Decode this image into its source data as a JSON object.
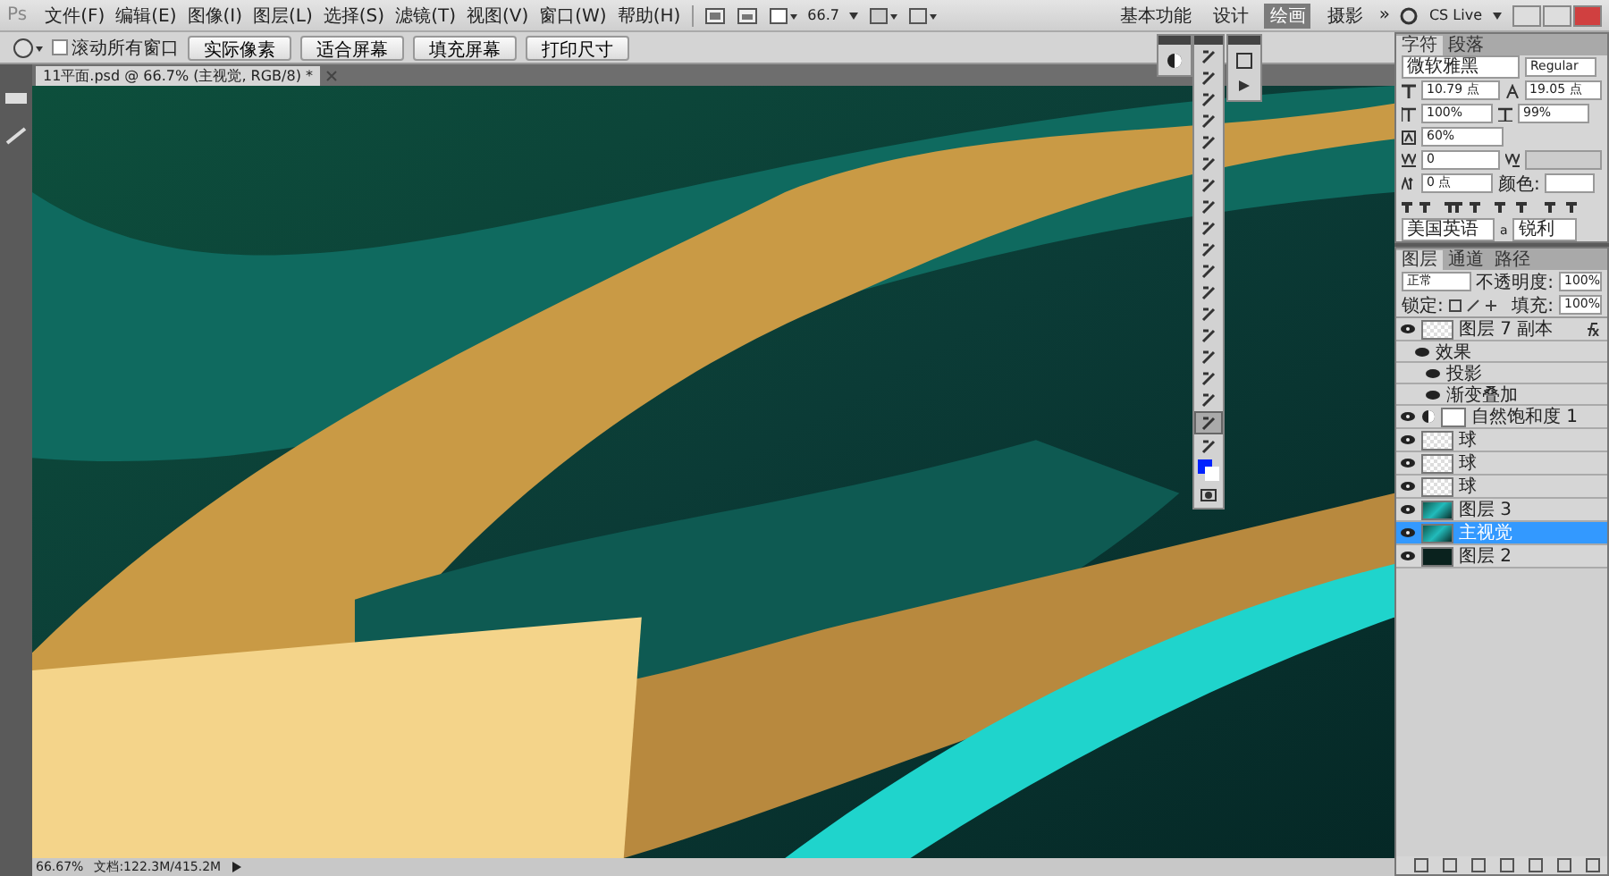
{
  "menu": {
    "logo": "Ps",
    "items": [
      "文件(F)",
      "编辑(E)",
      "图像(I)",
      "图层(L)",
      "选择(S)",
      "滤镜(T)",
      "视图(V)",
      "窗口(W)",
      "帮助(H)"
    ],
    "zoom": "66.7",
    "workspaces": [
      {
        "label": "基本功能",
        "selected": false
      },
      {
        "label": "设计",
        "selected": false
      },
      {
        "label": "绘画",
        "selected": true
      },
      {
        "label": "摄影",
        "selected": false
      }
    ],
    "more": "»",
    "cs_live": "CS Live"
  },
  "options": {
    "scroll_all": {
      "label": "滚动所有窗口",
      "checked": false
    },
    "buttons": [
      "实际像素",
      "适合屏幕",
      "填充屏幕",
      "打印尺寸"
    ]
  },
  "document": {
    "tab": "11平面.psd @ 66.7% (主视觉, RGB/8) *"
  },
  "tools": [
    {
      "selected": false
    },
    {
      "selected": false
    },
    {
      "selected": false
    },
    {
      "selected": false
    },
    {
      "selected": false
    },
    {
      "selected": false
    },
    {
      "selected": false
    },
    {
      "selected": false
    },
    {
      "selected": false
    },
    {
      "selected": false
    },
    {
      "selected": false
    },
    {
      "selected": false
    },
    {
      "selected": false
    },
    {
      "selected": false
    },
    {
      "selected": false
    },
    {
      "selected": false
    },
    {
      "selected": false
    },
    {
      "selected": true
    },
    {
      "selected": false
    }
  ],
  "character": {
    "tabs": [
      {
        "label": "字符",
        "selected": true
      },
      {
        "label": "段落",
        "selected": false
      }
    ],
    "font": "微软雅黑",
    "style": "Regular",
    "size": "10.79 点",
    "leading": "19.05 点",
    "vscale": "100%",
    "hscale": "99%",
    "tsume": "60%",
    "tracking": "0",
    "baseline": "0 点",
    "color_label": "颜色:",
    "language": "美国英语",
    "antialias_icon": "a",
    "antialias": "锐利"
  },
  "layers_panel": {
    "tabs": [
      {
        "label": "图层",
        "selected": true
      },
      {
        "label": "通道",
        "selected": false
      },
      {
        "label": "路径",
        "selected": false
      }
    ],
    "blend": "正常",
    "opacity_label": "不透明度:",
    "opacity": "100%",
    "lock_label": "锁定:",
    "fill_label": "填充:",
    "fill": "100%",
    "layers": [
      {
        "name": "图层 7 副本",
        "kind": "pixel",
        "fx": true,
        "selected": false,
        "effects_label": "效果",
        "effects": [
          "投影",
          "渐变叠加"
        ]
      },
      {
        "name": "自然饱和度 1",
        "kind": "adjustment",
        "fx": false,
        "selected": false
      },
      {
        "name": "球",
        "kind": "pixel",
        "fx": false,
        "selected": false
      },
      {
        "name": "球",
        "kind": "pixel",
        "fx": false,
        "selected": false
      },
      {
        "name": "球",
        "kind": "pixel",
        "fx": false,
        "selected": false
      },
      {
        "name": "图层 3",
        "kind": "image",
        "fx": false,
        "selected": false
      },
      {
        "name": "主视觉",
        "kind": "image",
        "fx": false,
        "selected": true
      },
      {
        "name": "图层 2",
        "kind": "dark",
        "fx": false,
        "selected": false
      }
    ]
  },
  "status": {
    "zoom": "66.67%",
    "doc": "文档:122.3M/415.2M"
  }
}
